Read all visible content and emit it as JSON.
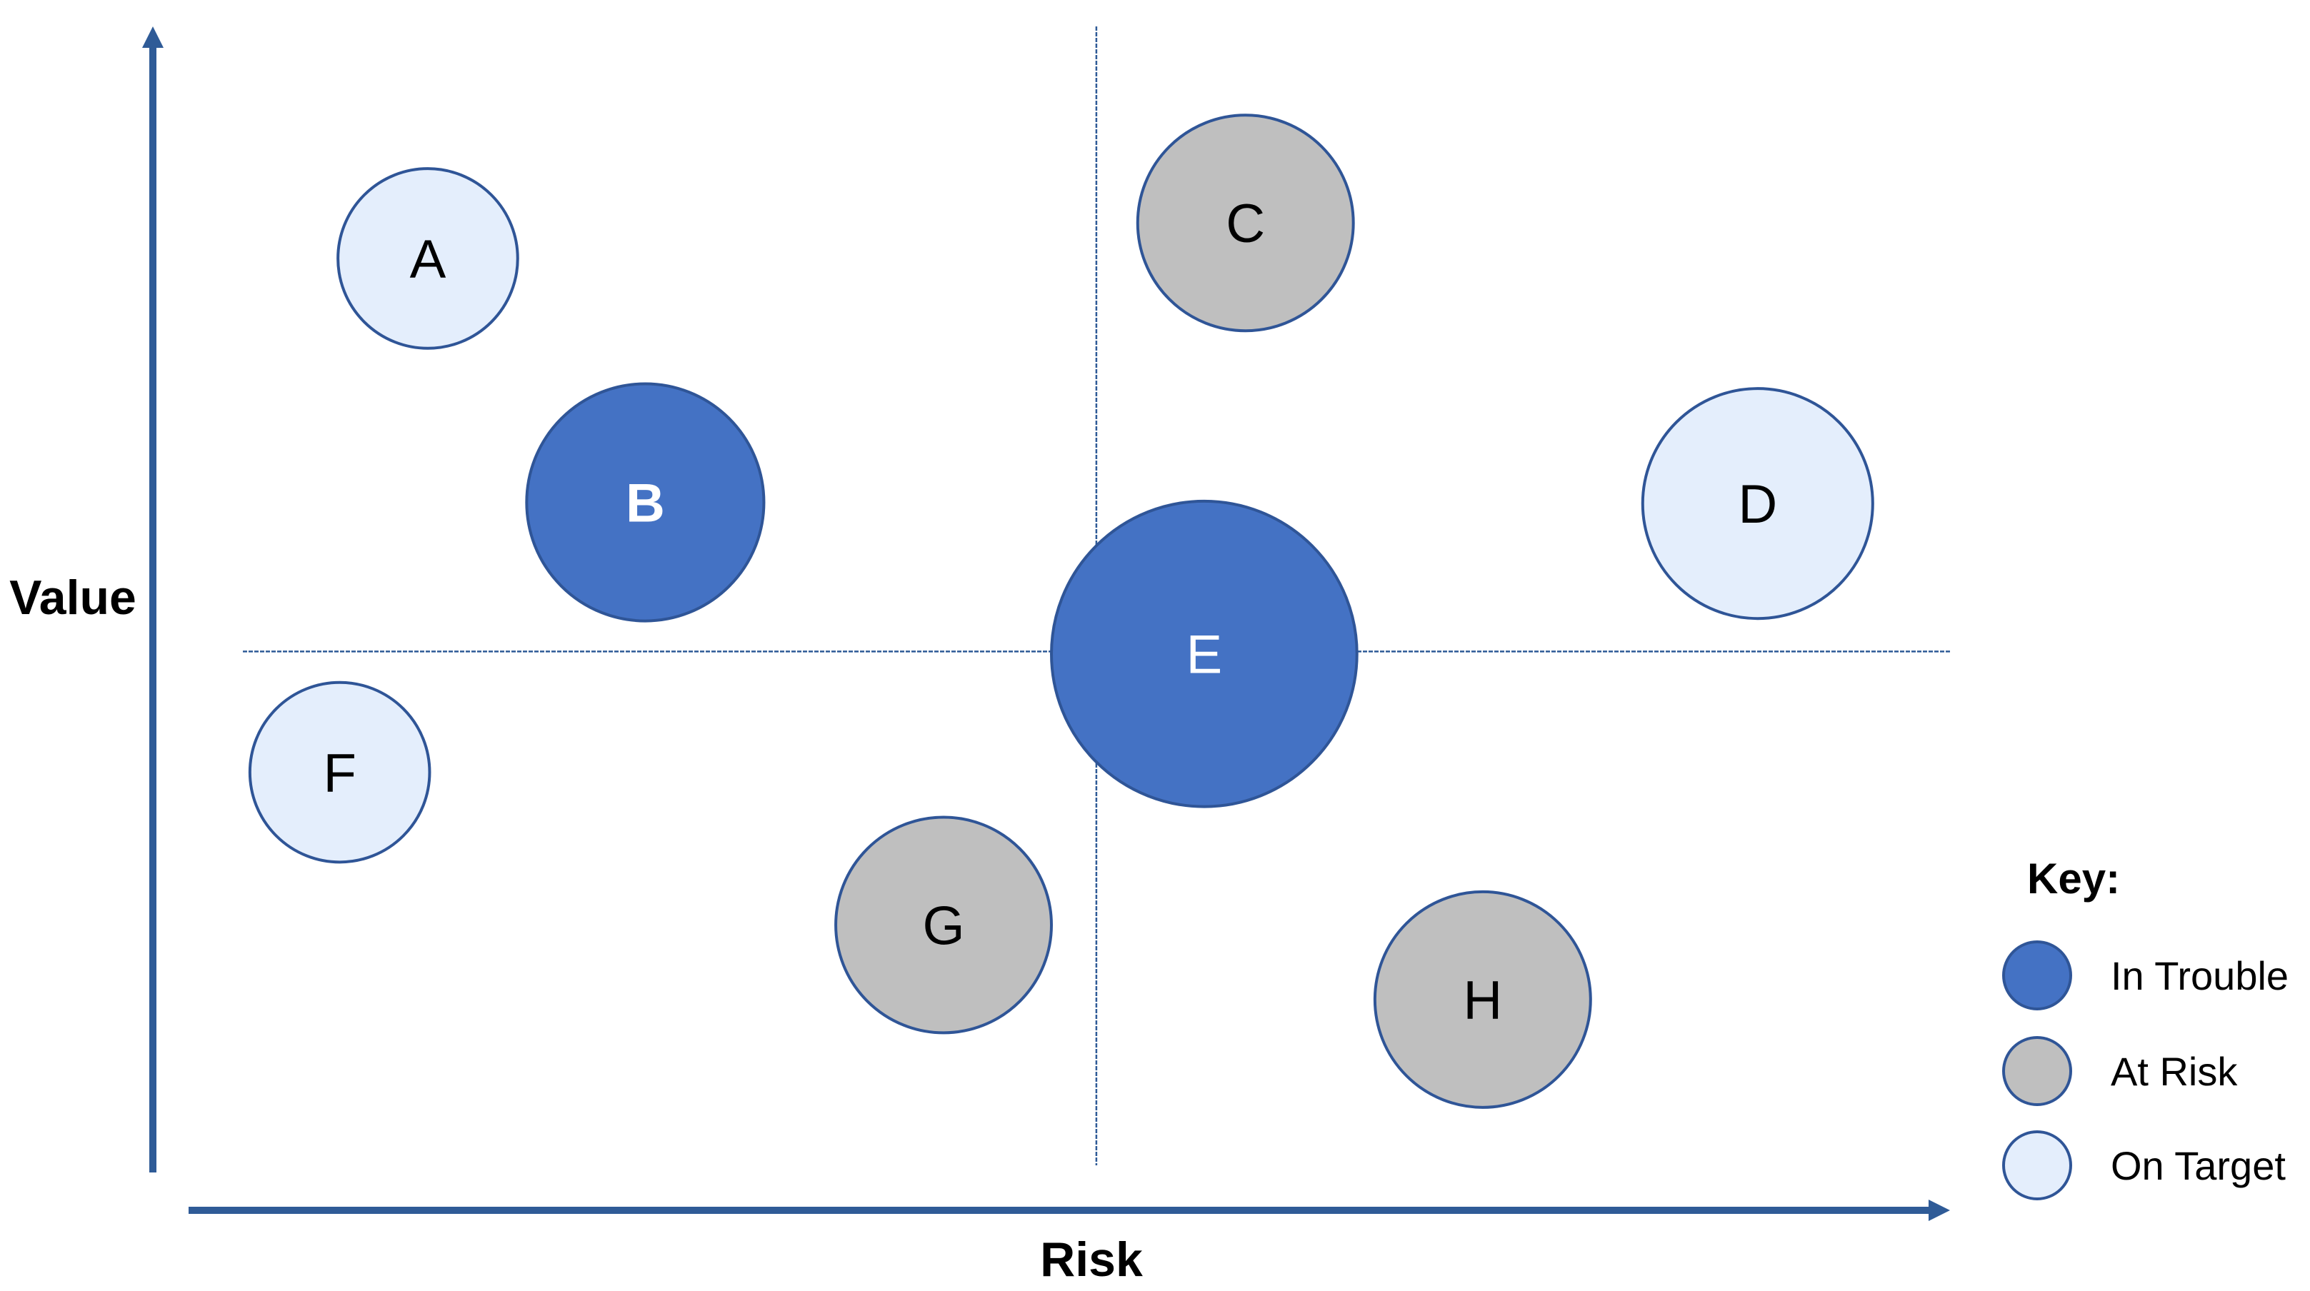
{
  "chart_data": {
    "type": "scatter",
    "subtype": "bubble-quadrant",
    "title": "",
    "xlabel": "Risk",
    "ylabel": "Value",
    "xlim": [
      0,
      100
    ],
    "ylim": [
      0,
      100
    ],
    "grid": false,
    "tick_labels": false,
    "quadrant_dividers": {
      "x": 52.5,
      "y": 47.2,
      "style": "dashed"
    },
    "legend": {
      "title": "Key:",
      "placement": "bottom-right",
      "entries": [
        {
          "status": "in_trouble",
          "label": "In Trouble"
        },
        {
          "status": "at_risk",
          "label": "At Risk"
        },
        {
          "status": "on_target",
          "label": "On Target"
        }
      ]
    },
    "status_styles": {
      "in_trouble": {
        "fill": "#4472C4",
        "text": "#FFFFFF"
      },
      "at_risk": {
        "fill": "#BFBFBF",
        "text": "#000000"
      },
      "on_target": {
        "fill": "#E4EEFC",
        "text": "#000000"
      }
    },
    "stroke_color": "#2F5597",
    "axis_color": "#2F5B97",
    "points": [
      {
        "label": "A",
        "x": 15.3,
        "y": 80.4,
        "size": 5.0,
        "status": "on_target",
        "bold": false
      },
      {
        "label": "B",
        "x": 27.4,
        "y": 59.8,
        "size": 6.6,
        "status": "in_trouble",
        "bold": true
      },
      {
        "label": "C",
        "x": 60.8,
        "y": 83.4,
        "size": 6.0,
        "status": "at_risk",
        "bold": false
      },
      {
        "label": "D",
        "x": 89.3,
        "y": 59.7,
        "size": 6.4,
        "status": "on_target",
        "bold": false
      },
      {
        "label": "E",
        "x": 58.5,
        "y": 47.0,
        "size": 8.5,
        "status": "in_trouble",
        "bold": false
      },
      {
        "label": "F",
        "x": 10.4,
        "y": 37.0,
        "size": 5.0,
        "status": "on_target",
        "bold": false
      },
      {
        "label": "G",
        "x": 44.0,
        "y": 24.1,
        "size": 6.0,
        "status": "at_risk",
        "bold": false
      },
      {
        "label": "H",
        "x": 74.0,
        "y": 17.8,
        "size": 6.0,
        "status": "at_risk",
        "bold": false
      }
    ]
  }
}
